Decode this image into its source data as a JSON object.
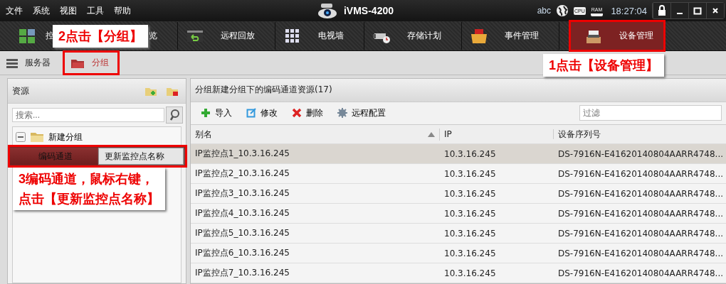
{
  "menu": [
    "文件",
    "系统",
    "视图",
    "工具",
    "帮助"
  ],
  "app_title": "iVMS-4200",
  "status": {
    "input": "abc",
    "indicators": [
      "CPU",
      "RAM"
    ],
    "time": "18:27:04"
  },
  "toolbar_tabs": [
    {
      "label_visible": [
        "控",
        "览"
      ],
      "selected": false
    },
    {
      "label": "远程回放",
      "selected": false
    },
    {
      "label": "电视墙",
      "selected": false
    },
    {
      "label": "存储计划",
      "selected": false
    },
    {
      "label": "事件管理",
      "selected": false
    },
    {
      "label": "设备管理",
      "selected": true
    }
  ],
  "subtabs": [
    {
      "label": "服务器",
      "selected": false
    },
    {
      "label": "分组",
      "selected": true
    }
  ],
  "resources": {
    "title": "资源",
    "search_placeholder": "搜索...",
    "tree": [
      {
        "label": "新建分组",
        "expanded": true,
        "children": [
          {
            "label": "编码通道",
            "selected": true
          }
        ]
      }
    ]
  },
  "context_menu": [
    {
      "label": "更新监控点名称"
    }
  ],
  "channels": {
    "title": "分组新建分组下的编码通道资源(17)",
    "actions": [
      {
        "label": "导入",
        "kind": "add"
      },
      {
        "label": "修改",
        "kind": "edit"
      },
      {
        "label": "删除",
        "kind": "delete"
      },
      {
        "label": "远程配置",
        "kind": "config"
      }
    ],
    "filter_placeholder": "过滤",
    "columns": [
      "别名",
      "IP",
      "设备序列号"
    ],
    "rows": [
      {
        "cells": [
          "IP监控点1_10.3.16.245",
          "10.3.16.245",
          "DS-7916N-E41620140804AARR4748..."
        ],
        "selected": true
      },
      {
        "cells": [
          "IP监控点2_10.3.16.245",
          "10.3.16.245",
          "DS-7916N-E41620140804AARR4748..."
        ],
        "selected": false
      },
      {
        "cells": [
          "IP监控点3_10.3.16.245",
          "10.3.16.245",
          "DS-7916N-E41620140804AARR4748..."
        ],
        "selected": false
      },
      {
        "cells": [
          "IP监控点4_10.3.16.245",
          "10.3.16.245",
          "DS-7916N-E41620140804AARR4748..."
        ],
        "selected": false
      },
      {
        "cells": [
          "IP监控点5_10.3.16.245",
          "10.3.16.245",
          "DS-7916N-E41620140804AARR4748..."
        ],
        "selected": false
      },
      {
        "cells": [
          "IP监控点6_10.3.16.245",
          "10.3.16.245",
          "DS-7916N-E41620140804AARR4748..."
        ],
        "selected": false
      },
      {
        "cells": [
          "IP监控点7_10.3.16.245",
          "10.3.16.245",
          "DS-7916N-E41620140804AARR4748..."
        ],
        "selected": false
      }
    ]
  },
  "annotations": [
    {
      "lines": [
        "1点击【设备管理】"
      ]
    },
    {
      "lines": [
        "2点击【分组】"
      ]
    },
    {
      "lines": [
        "3编码通道，鼠标右键，",
        "点击【更新监控点名称】"
      ]
    }
  ]
}
